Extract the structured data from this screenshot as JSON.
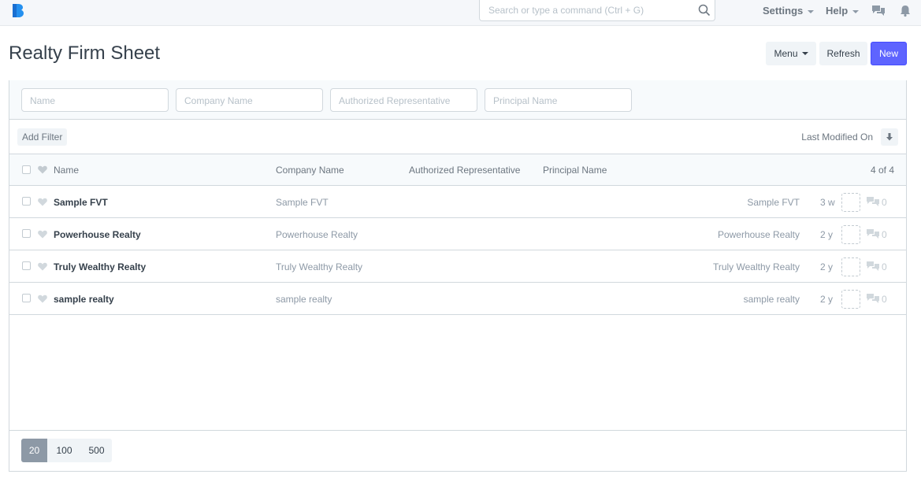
{
  "navbar": {
    "search_placeholder": "Search or type a command (Ctrl + G)",
    "settings_label": "Settings",
    "help_label": "Help",
    "icons": [
      "app-logo-icon",
      "search-icon",
      "chat-icon",
      "bell-icon"
    ]
  },
  "page": {
    "title": "Realty Firm Sheet",
    "menu_label": "Menu",
    "refresh_label": "Refresh",
    "new_label": "New",
    "accent_color": "#5e64ff"
  },
  "filters": {
    "name_placeholder": "Name",
    "company_placeholder": "Company Name",
    "rep_placeholder": "Authorized Representative",
    "principal_placeholder": "Principal Name",
    "add_filter_label": "Add Filter",
    "sort_label": "Last Modified On"
  },
  "list": {
    "columns": [
      "Name",
      "Company Name",
      "Authorized Representative",
      "Principal Name"
    ],
    "count": "4 of 4",
    "rows": [
      {
        "name": "Sample FVT",
        "company": "Sample FVT",
        "right": "Sample FVT",
        "time": "3 w",
        "comments": "0"
      },
      {
        "name": "Powerhouse Realty",
        "company": "Powerhouse Realty",
        "right": "Powerhouse Realty",
        "time": "2 y",
        "comments": "0"
      },
      {
        "name": "Truly Wealthy Realty",
        "company": "Truly Wealthy Realty",
        "right": "Truly Wealthy Realty",
        "time": "2 y",
        "comments": "0"
      },
      {
        "name": "sample realty",
        "company": "sample realty",
        "right": "sample realty",
        "time": "2 y",
        "comments": "0"
      }
    ]
  },
  "paging": {
    "options": [
      "20",
      "100",
      "500"
    ],
    "selected": "20"
  }
}
